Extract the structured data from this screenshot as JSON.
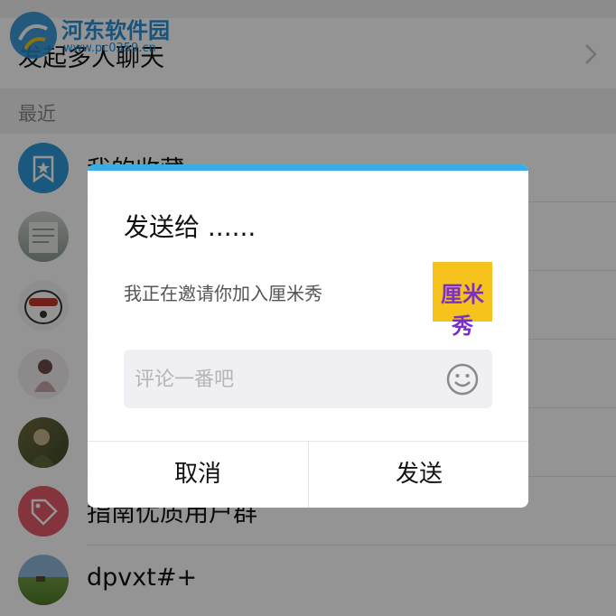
{
  "watermark": {
    "site_name": "河东软件园",
    "site_url": "www.pc0359.cn"
  },
  "top_item": {
    "label": "发起多人聊天"
  },
  "section": {
    "recent_label": "最近"
  },
  "contacts": [
    {
      "label": "我的收藏"
    },
    {
      "label": ""
    },
    {
      "label": ""
    },
    {
      "label": ""
    },
    {
      "label": ""
    },
    {
      "label": "指南优质用户群"
    },
    {
      "label": "dpvxt#+"
    }
  ],
  "dialog": {
    "title": "发送给 ......",
    "message": "我正在邀请你加入厘米秀",
    "thumbnail_text": "厘米秀",
    "comment_placeholder": "评论一番吧",
    "cancel_label": "取消",
    "send_label": "发送",
    "accent_color": "#39aee6"
  },
  "colors": {
    "favorites_icon": "#2d9ad7",
    "group_icon": "#e25a6a"
  }
}
